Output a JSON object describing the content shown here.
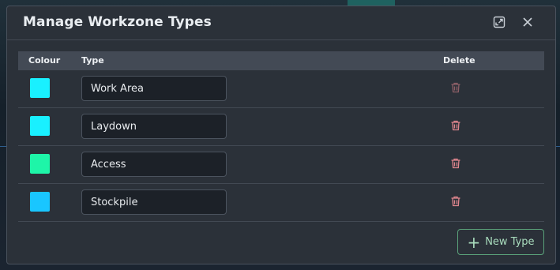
{
  "dialog": {
    "title": "Manage Workzone Types",
    "expand_icon": "expand-icon",
    "close_icon": "close-icon"
  },
  "table": {
    "headers": {
      "colour": "Colour",
      "type": "Type",
      "delete": "Delete"
    },
    "rows": [
      {
        "color": "#19f0ff",
        "type": "Work Area"
      },
      {
        "color": "#19f0ff",
        "type": "Laydown"
      },
      {
        "color": "#1ef5a8",
        "type": "Access"
      },
      {
        "color": "#19c6ff",
        "type": "Stockpile"
      }
    ]
  },
  "footer": {
    "new_type_label": "New Type"
  },
  "colors": {
    "dialog_bg": "#2b3139",
    "header_row_bg": "#434a55",
    "delete_icon": "#e0868e",
    "accent_green": "#5aa27a"
  }
}
